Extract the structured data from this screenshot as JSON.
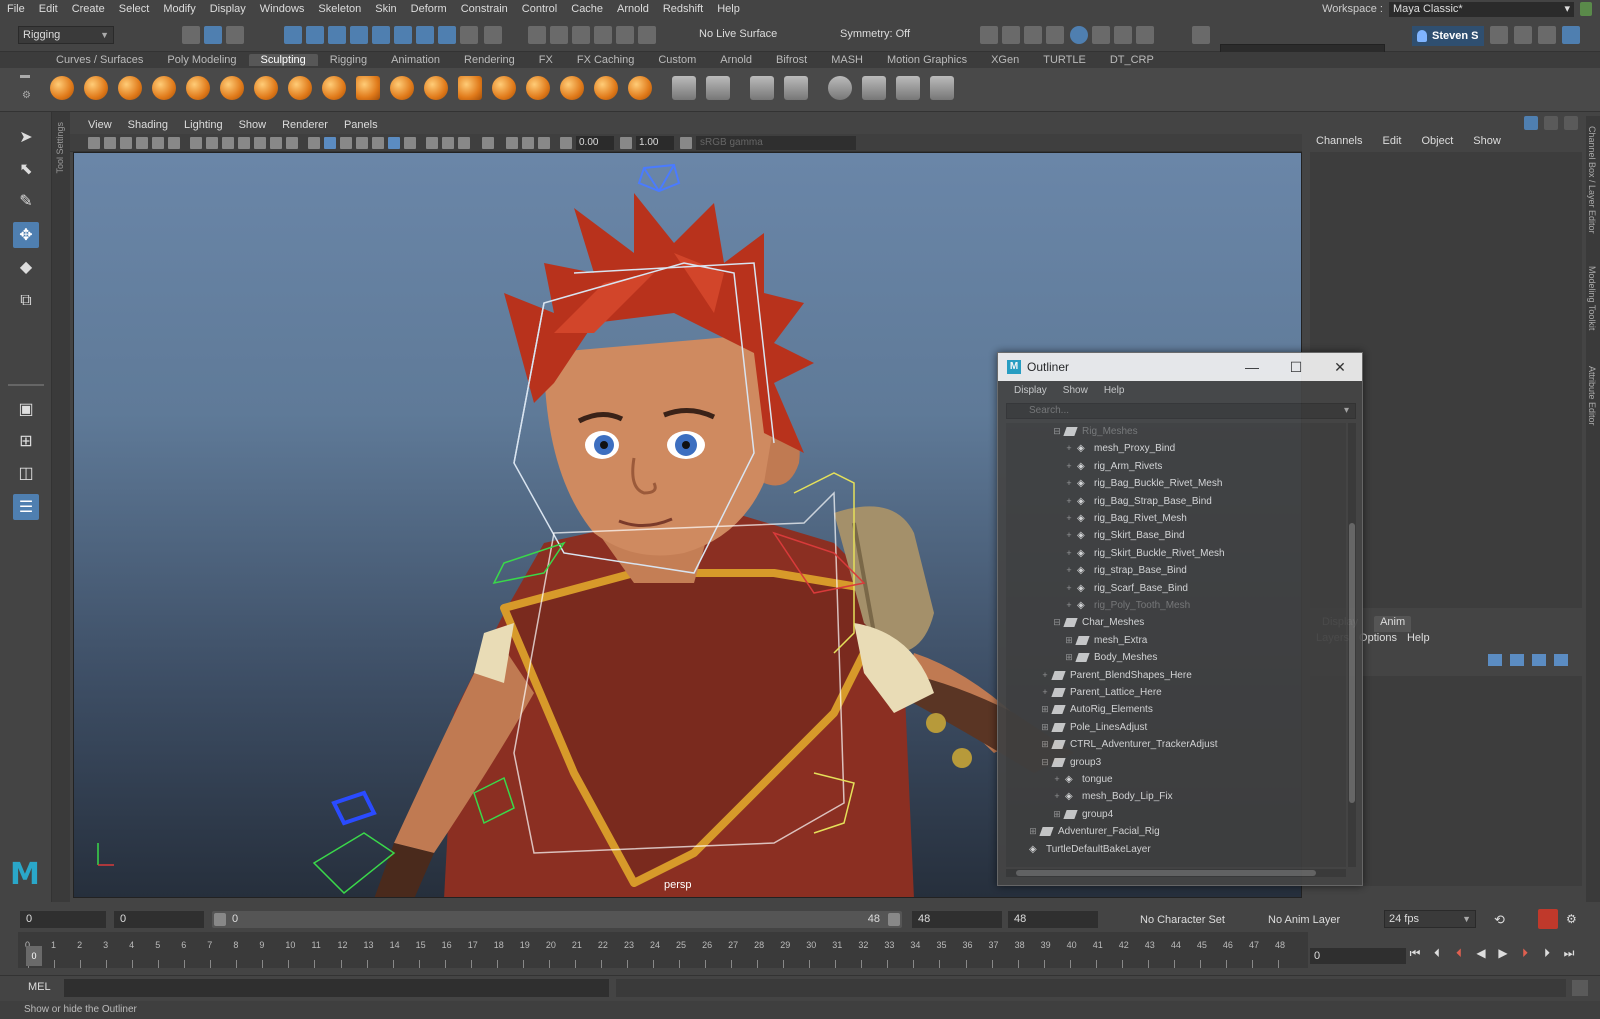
{
  "menubar": {
    "items": [
      "File",
      "Edit",
      "Create",
      "Select",
      "Modify",
      "Display",
      "Windows",
      "Skeleton",
      "Skin",
      "Deform",
      "Constrain",
      "Control",
      "Cache",
      "Arnold",
      "Redshift",
      "Help"
    ],
    "workspace_label": "Workspace :",
    "workspace_value": "Maya Classic*"
  },
  "status": {
    "menuset": "Rigging",
    "live_surface": "No Live Surface",
    "symmetry": "Symmetry: Off",
    "user": "Steven S"
  },
  "shelf": {
    "tabs": [
      "Curves / Surfaces",
      "Poly Modeling",
      "Sculpting",
      "Rigging",
      "Animation",
      "Rendering",
      "FX",
      "FX Caching",
      "Custom",
      "Arnold",
      "Bifrost",
      "MASH",
      "Motion Graphics",
      "XGen",
      "TURTLE",
      "DT_CRP"
    ],
    "active_tab": "Sculpting"
  },
  "toolsettings_tab": "Tool Settings",
  "viewport": {
    "menu": [
      "View",
      "Shading",
      "Lighting",
      "Show",
      "Renderer",
      "Panels"
    ],
    "exposure": "0.00",
    "gamma": "1.00",
    "color_space": "sRGB gamma",
    "camera_label": "persp"
  },
  "channelbox": {
    "tabs": [
      "Channels",
      "Edit",
      "Object",
      "Show"
    ],
    "layer_tabs": [
      "Display",
      "Anim"
    ],
    "layer_menu": [
      "Layers",
      "Options",
      "Help"
    ]
  },
  "side_tabs": [
    "Channel Box / Layer Editor",
    "Modeling Toolkit",
    "Attribute Editor"
  ],
  "outliner": {
    "title": "Outliner",
    "menu": [
      "Display",
      "Show",
      "Help"
    ],
    "search_placeholder": "Search...",
    "rows": [
      {
        "label": "Rig_Meshes",
        "indent": 3,
        "icon": "group",
        "faded": true,
        "exp": "⊟"
      },
      {
        "label": "mesh_Proxy_Bind",
        "indent": 4,
        "icon": "joint",
        "exp": "+"
      },
      {
        "label": "rig_Arm_Rivets",
        "indent": 4,
        "icon": "joint",
        "exp": "+"
      },
      {
        "label": "rig_Bag_Buckle_Rivet_Mesh",
        "indent": 4,
        "icon": "joint",
        "exp": "+"
      },
      {
        "label": "rig_Bag_Strap_Base_Bind",
        "indent": 4,
        "icon": "joint",
        "exp": "+"
      },
      {
        "label": "rig_Bag_Rivet_Mesh",
        "indent": 4,
        "icon": "joint",
        "exp": "+"
      },
      {
        "label": "rig_Skirt_Base_Bind",
        "indent": 4,
        "icon": "joint",
        "exp": "+"
      },
      {
        "label": "rig_Skirt_Buckle_Rivet_Mesh",
        "indent": 4,
        "icon": "joint",
        "exp": "+"
      },
      {
        "label": "rig_strap_Base_Bind",
        "indent": 4,
        "icon": "joint",
        "exp": "+"
      },
      {
        "label": "rig_Scarf_Base_Bind",
        "indent": 4,
        "icon": "joint",
        "exp": "+"
      },
      {
        "label": "rig_Poly_Tooth_Mesh",
        "indent": 4,
        "icon": "joint",
        "faded": true,
        "exp": "+"
      },
      {
        "label": "Char_Meshes",
        "indent": 3,
        "icon": "group",
        "exp": "⊟"
      },
      {
        "label": "mesh_Extra",
        "indent": 4,
        "icon": "group",
        "exp": "⊞"
      },
      {
        "label": "Body_Meshes",
        "indent": 4,
        "icon": "group",
        "exp": "⊞"
      },
      {
        "label": "Parent_BlendShapes_Here",
        "indent": 2,
        "icon": "group",
        "exp": "+"
      },
      {
        "label": "Parent_Lattice_Here",
        "indent": 2,
        "icon": "group",
        "exp": "+"
      },
      {
        "label": "AutoRig_Elements",
        "indent": 2,
        "icon": "group",
        "exp": "⊞"
      },
      {
        "label": "Pole_LinesAdjust",
        "indent": 2,
        "icon": "group",
        "exp": "⊞"
      },
      {
        "label": "CTRL_Adventurer_TrackerAdjust",
        "indent": 2,
        "icon": "group",
        "exp": "⊞"
      },
      {
        "label": "group3",
        "indent": 2,
        "icon": "group",
        "exp": "⊟"
      },
      {
        "label": "tongue",
        "indent": 3,
        "icon": "joint",
        "exp": "+"
      },
      {
        "label": "mesh_Body_Lip_Fix",
        "indent": 3,
        "icon": "joint",
        "exp": "+"
      },
      {
        "label": "group4",
        "indent": 3,
        "icon": "group",
        "exp": "⊞"
      },
      {
        "label": "Adventurer_Facial_Rig",
        "indent": 1,
        "icon": "group",
        "exp": "⊞"
      },
      {
        "label": "TurtleDefaultBakeLayer",
        "indent": 0,
        "icon": "joint",
        "exp": ""
      }
    ]
  },
  "range": {
    "start": "0",
    "anim_start": "0",
    "slider_start": "0",
    "slider_end": "48",
    "anim_end": "48",
    "end": "48",
    "character_set": "No Character Set",
    "anim_layer": "No Anim Layer",
    "fps": "24 fps"
  },
  "timeline": {
    "frames": [
      "0",
      "1",
      "2",
      "3",
      "4",
      "5",
      "6",
      "7",
      "8",
      "9",
      "10",
      "11",
      "12",
      "13",
      "14",
      "15",
      "16",
      "17",
      "18",
      "19",
      "20",
      "21",
      "22",
      "23",
      "24",
      "25",
      "26",
      "27",
      "28",
      "29",
      "30",
      "31",
      "32",
      "33",
      "34",
      "35",
      "36",
      "37",
      "38",
      "39",
      "40",
      "41",
      "42",
      "43",
      "44",
      "45",
      "46",
      "47",
      "48"
    ],
    "current_frame": "0",
    "current_frame_field": "0"
  },
  "commandline": {
    "label": "MEL"
  },
  "helpline": {
    "text": "Show or hide the Outliner"
  }
}
